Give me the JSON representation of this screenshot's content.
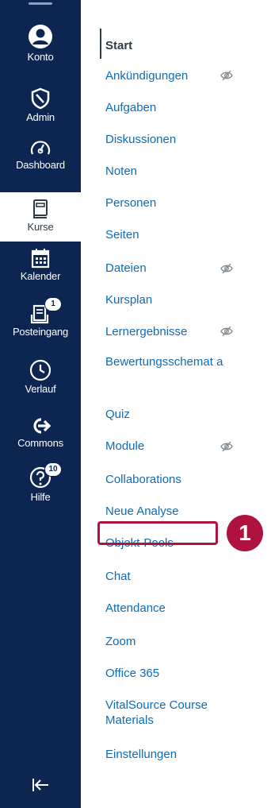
{
  "global_nav": {
    "items": [
      {
        "key": "konto",
        "label": "Konto",
        "icon": "user-icon"
      },
      {
        "key": "admin",
        "label": "Admin",
        "icon": "shield-icon"
      },
      {
        "key": "dashboard",
        "label": "Dashboard",
        "icon": "dashboard-icon"
      },
      {
        "key": "kurse",
        "label": "Kurse",
        "icon": "book-icon",
        "active": true
      },
      {
        "key": "kalender",
        "label": "Kalender",
        "icon": "calendar-icon"
      },
      {
        "key": "posteingang",
        "label": "Posteingang",
        "icon": "inbox-icon",
        "badge": "1"
      },
      {
        "key": "verlauf",
        "label": "Verlauf",
        "icon": "clock-icon"
      },
      {
        "key": "commons",
        "label": "Commons",
        "icon": "commons-icon"
      },
      {
        "key": "hilfe",
        "label": "Hilfe",
        "icon": "help-icon",
        "badge": "10"
      }
    ],
    "collapse_icon": "collapse-icon"
  },
  "course_nav": {
    "items": [
      {
        "label": "Start",
        "active": true
      },
      {
        "label": "Ankündigungen",
        "hidden": true
      },
      {
        "label": "Aufgaben"
      },
      {
        "label": "Diskussionen"
      },
      {
        "label": "Noten"
      },
      {
        "label": "Personen"
      },
      {
        "label": "Seiten"
      },
      {
        "label": "Dateien",
        "hidden": true
      },
      {
        "label": "Kursplan"
      },
      {
        "label": "Lernergebnisse",
        "hidden": true
      },
      {
        "label": "Bewertungsschemat a"
      },
      {
        "label": "Quiz"
      },
      {
        "label": "Module",
        "hidden": true
      },
      {
        "label": "Collaborations"
      },
      {
        "label": "Neue Analyse"
      },
      {
        "label": "Objekt-Pools",
        "highlighted": true
      },
      {
        "label": "Chat"
      },
      {
        "label": "Attendance"
      },
      {
        "label": "Zoom"
      },
      {
        "label": "Office 365"
      },
      {
        "label": "VitalSource Course Materials"
      },
      {
        "label": "Einstellungen"
      }
    ]
  },
  "callout": {
    "number": "1"
  },
  "colors": {
    "nav_bg": "#0c2551",
    "link": "#0f6bb6",
    "highlight": "#b01240",
    "text": "#2d3b45"
  }
}
